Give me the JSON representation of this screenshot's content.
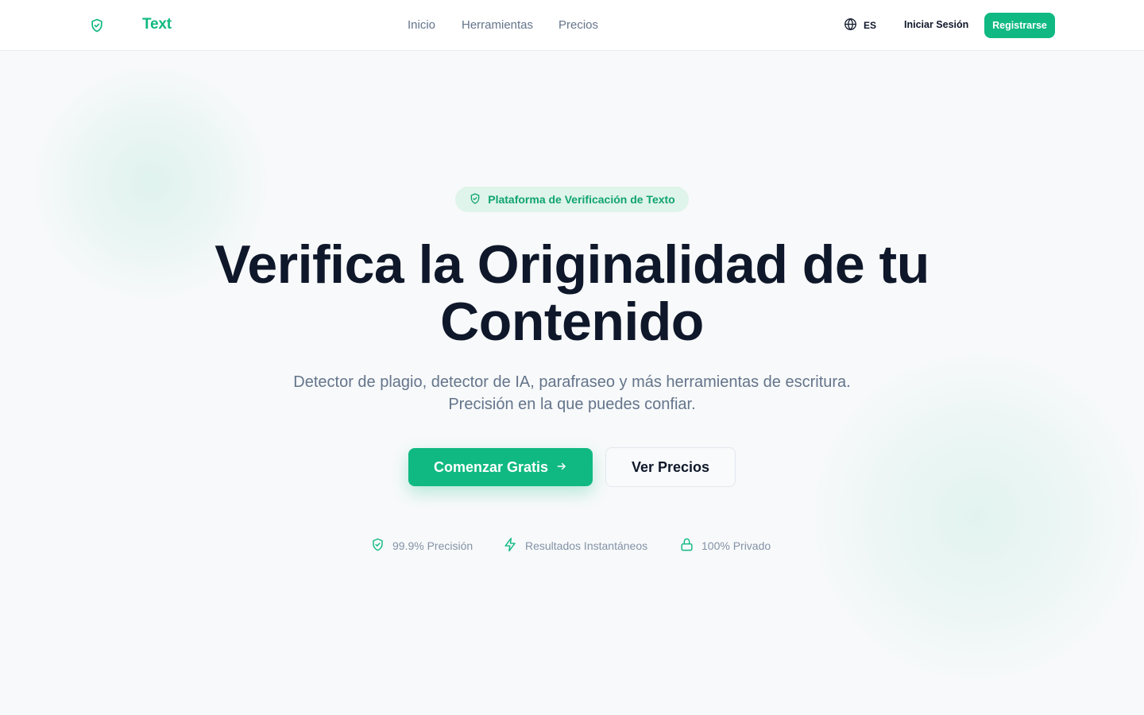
{
  "colors": {
    "brand": "#10b981",
    "heading": "#0f172a",
    "muted": "#64748b",
    "badge_bg": "#dff4ea"
  },
  "header": {
    "logo_icon": "shield-check-icon",
    "logo_text": "Text",
    "nav": [
      "Inicio",
      "Herramientas",
      "Precios"
    ],
    "language": {
      "icon": "globe-icon",
      "code": "ES"
    },
    "login_label": "Iniciar Sesión",
    "register_label": "Registrarse"
  },
  "hero": {
    "badge": {
      "icon": "shield-check-icon",
      "label": "Plataforma de Verificación de Texto"
    },
    "title": "Verifica la Originalidad de tu Contenido",
    "subtitle": "Detector de plagio, detector de IA, parafraseo y más herramientas de escritura. Precisión en la que puedes confiar.",
    "primary_cta": {
      "label": "Comenzar Gratis",
      "icon": "arrow-right-icon"
    },
    "secondary_cta": {
      "label": "Ver Precios"
    },
    "features": [
      {
        "icon": "shield-check-icon",
        "label": "99.9% Precisión"
      },
      {
        "icon": "lightning-icon",
        "label": "Resultados Instantáneos"
      },
      {
        "icon": "lock-icon",
        "label": "100% Privado"
      }
    ]
  }
}
